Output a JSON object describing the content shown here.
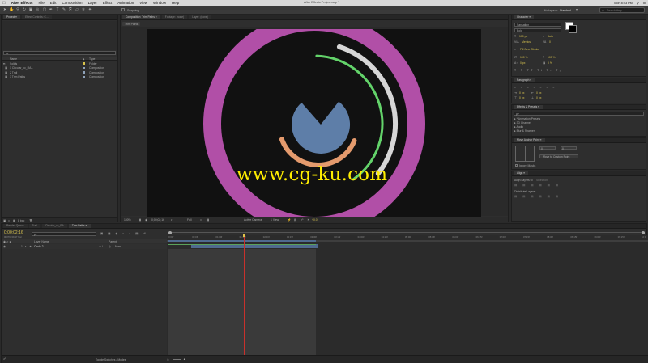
{
  "menubar": {
    "apple": "",
    "app_name": "After Effects",
    "menus": [
      "File",
      "Edit",
      "Composition",
      "Layer",
      "Effect",
      "Animation",
      "View",
      "Window",
      "Help"
    ],
    "window_title": "After Effects Project.aep *",
    "clock": "Mon 8:43 PM",
    "search_icon": "magnifier"
  },
  "toolbar": {
    "snapping_label": "Snapping",
    "workspace_label": "Workspace:",
    "workspace_value": "Standard",
    "search_placeholder": "Search Help"
  },
  "project_panel": {
    "tab_project": "Project ≡",
    "tab_effect_controls": "Effect Controls: C...",
    "search_placeholder": "ρ▾",
    "col_name": "Name",
    "col_type": "Type",
    "rows": [
      {
        "name": "Solids",
        "type": "Folder",
        "color": "#d8c34a"
      },
      {
        "name": "1 Circular_cc_RA...",
        "type": "Composition",
        "color": "#8ea1b8"
      },
      {
        "name": "2 Trail",
        "type": "Composition",
        "color": "#8ea1b8"
      },
      {
        "name": "3 Trim Paths",
        "type": "Composition",
        "color": "#8ea1b8"
      }
    ],
    "footer_bpc": "8 bpc"
  },
  "composition_panel": {
    "tab_comp": "Composition: Trim Paths ≡",
    "tab_footage": "Footage: (none)",
    "tab_layer": "Layer: (none)",
    "breadcrumb": "Trim Paths",
    "zoom": "100%",
    "timecode": "0;00;02;16",
    "resolution": "Full",
    "camera": "Active Camera",
    "views": "1 View",
    "exposure": "+0.0"
  },
  "watermark": "www.cg-ku.com",
  "character_panel": {
    "tab": "Character ≡",
    "font": "Sansation",
    "style": "Bold",
    "size": "100 px",
    "leading": "Auto",
    "kerning": "Metrics",
    "tracking": "0",
    "stroke": "Fill Over Stroke",
    "vscale": "100 %",
    "hscale": "100 %",
    "baseline": "0 px",
    "tsume": "0 %"
  },
  "paragraph_panel": {
    "tab": "Paragraph ≡",
    "indent_left": "0 px",
    "indent_right": "0 px",
    "space_before": "0 px",
    "space_after": "0 px"
  },
  "effects_panel": {
    "tab": "Effects & Presets ≡",
    "search_placeholder": "ρ▾",
    "items": [
      "▸ * Animation Presets",
      "▸ 3D Channel",
      "▸ Audio",
      "▸ Blur & Sharpen"
    ]
  },
  "anchor_panel": {
    "tab": "Move Anchor Point ≡",
    "x_value": "0",
    "y_value": "0",
    "custom_label": "Move to Custom Point",
    "ignore_label": "Ignore Masks"
  },
  "align_panel": {
    "tab": "Align ≡",
    "align_to_label": "Align Layers to:",
    "align_to_value": "Selection",
    "distribute_label": "Distribute Layers:"
  },
  "bottom_strip": {
    "bpc": "8 bpc"
  },
  "timeline": {
    "tab_render": "Render Queue",
    "tab_trail": "Trail",
    "tab_circular": "Circular_cc_RA",
    "tab_trim": "Trim Paths ≡",
    "timecode": "0;00;02;16",
    "fps": "00076 (29.97 fps)",
    "search_placeholder": "ρ▾",
    "col_source": "Layer Name",
    "col_parent": "Parent",
    "layer_index": "1",
    "layer_name": "Circle 2",
    "layer_parent": "None",
    "ruler_ticks": [
      "0:00f",
      "00:15f",
      "01:00f",
      "01:15f",
      "02:00f",
      "02:15f",
      "03:00f",
      "03:15f",
      "04:00f",
      "04:15f",
      "05:00f",
      "05:15f",
      "06:00f",
      "06:15f",
      "07:00f",
      "07:15f",
      "08:00f",
      "08:15f",
      "09:00f",
      "09:15f",
      "10:0"
    ],
    "toggle_label": "Toggle Switches / Modes",
    "work_area_start": 0,
    "work_area_end_fraction": 0.31,
    "playhead_fraction": 0.16
  },
  "artwork": {
    "outer_ring_color": "#b14fa7",
    "white_arc_color": "#d6d6d6",
    "green_arc_color": "#63d36a",
    "orange_arc_color": "#e49a6d",
    "pie_color": "#5e7ea8",
    "pie_fraction": 0.78,
    "background_color": "#111111"
  }
}
